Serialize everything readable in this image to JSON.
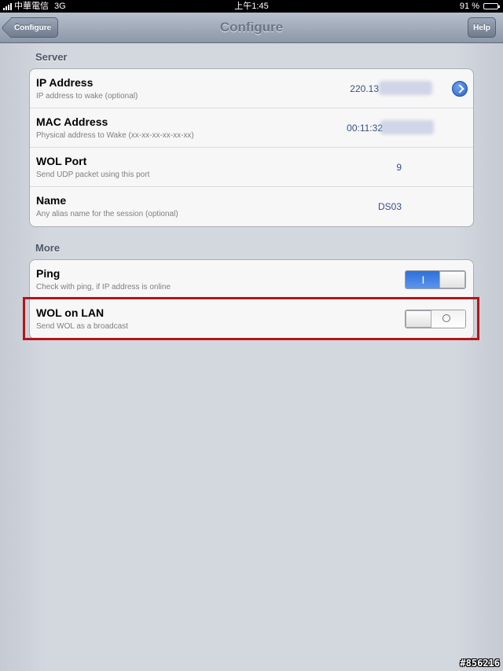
{
  "status_bar": {
    "carrier": "中華電信",
    "network": "3G",
    "time": "上午1:45",
    "battery": "91 %",
    "battery_level": 0.91
  },
  "nav": {
    "title": "Configure",
    "back_label": "Configure",
    "help_label": "Help"
  },
  "sections": {
    "server": {
      "header": "Server",
      "rows": [
        {
          "title": "IP Address",
          "subtitle": "IP address to wake (optional)",
          "value": "220.13"
        },
        {
          "title": "MAC Address",
          "subtitle": "Physical address to Wake (xx-xx-xx-xx-xx-xx)",
          "value": "00:11:32"
        },
        {
          "title": "WOL Port",
          "subtitle": "Send UDP packet using this port",
          "value": "9"
        },
        {
          "title": "Name",
          "subtitle": "Any alias name for the session (optional)",
          "value": "DS03"
        }
      ]
    },
    "more": {
      "header": "More",
      "rows": [
        {
          "title": "Ping",
          "subtitle": "Check with ping, if IP address is online",
          "switch_on": true,
          "on_glyph": "I"
        },
        {
          "title": "WOL on LAN",
          "subtitle": "Send WOL as a broadcast",
          "switch_on": false
        }
      ]
    }
  },
  "colors": {
    "value_text": "#34508a",
    "switch_on": "#2f6fd8",
    "highlight": "#b4151b"
  },
  "watermark": "#856216"
}
